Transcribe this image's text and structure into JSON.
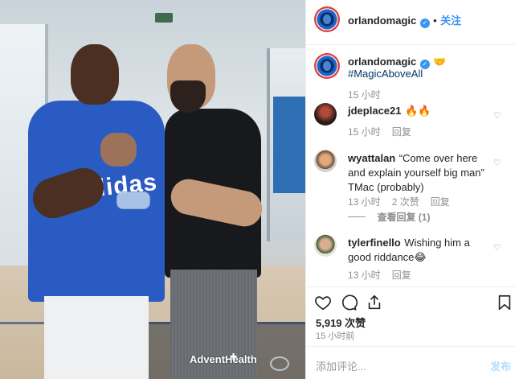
{
  "post": {
    "author": "orlandomagic",
    "follow_label": "关注",
    "verified_mark": "✓"
  },
  "caption": {
    "author": "orlandomagic",
    "emoji": "🤝",
    "hashtag": "#MagicAboveAll",
    "time": "15 小时"
  },
  "comments": [
    {
      "user": "jdeplace21",
      "text": "🔥🔥",
      "time": "15 小时",
      "reply": "回复"
    },
    {
      "user": "wyattalan",
      "text": "“Come over here and explain yourself big man” TMac (probably)",
      "time": "13 小时",
      "likes": "2 次赞",
      "reply": "回复",
      "view_replies": "查看回复 (1)"
    },
    {
      "user": "tylerfinello",
      "text": "Wishing him a good riddance😂",
      "time": "13 小时",
      "reply": "回复"
    }
  ],
  "stats": {
    "likes": "5,919 次赞",
    "posted": "15 小时前"
  },
  "add_comment": {
    "placeholder": "添加评论...",
    "post_label": "发布"
  },
  "photo": {
    "watermark": "AdventHealth",
    "shirt_logo": "adidas"
  },
  "icons": {
    "heart": "heart-icon",
    "comment": "comment-icon",
    "share": "share-icon",
    "bookmark": "bookmark-icon"
  },
  "colors": {
    "accent": "#3897f0",
    "text": "#262626",
    "muted": "#8e8e8e"
  }
}
